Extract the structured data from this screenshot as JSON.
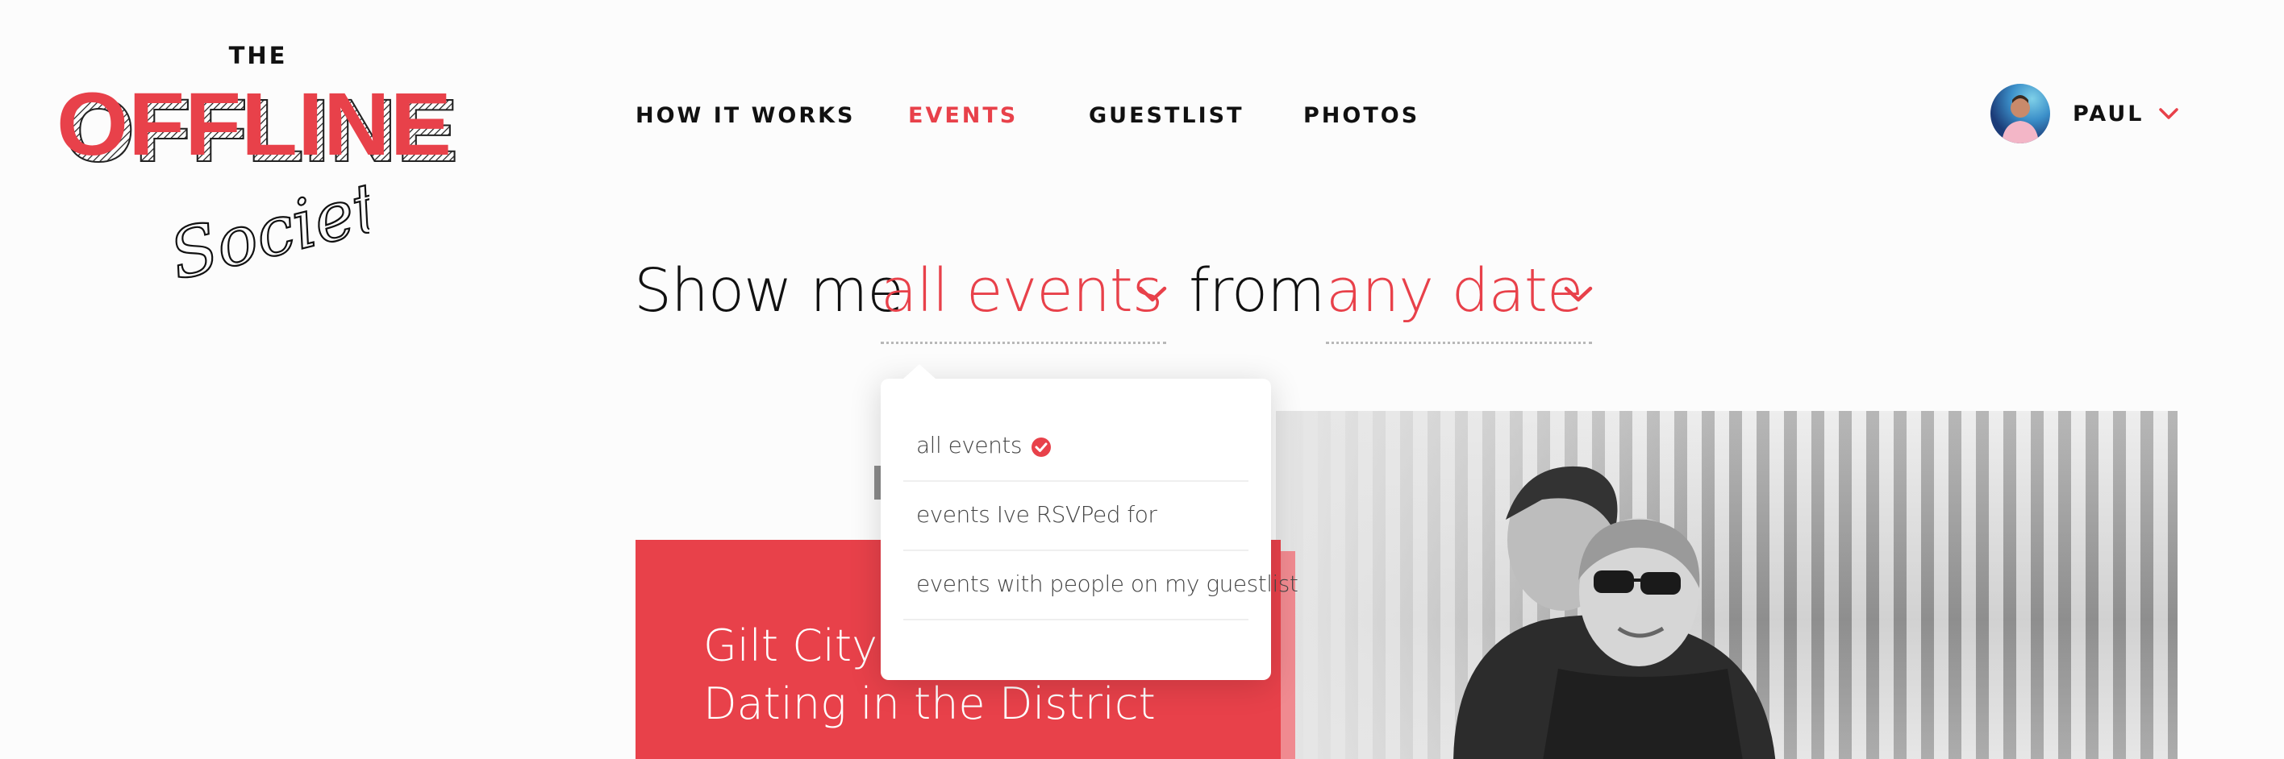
{
  "brand": {
    "logo_the": "THE",
    "logo_offline": "OFFLINE",
    "logo_society": "Society",
    "accent_color": "#e8414a"
  },
  "nav": {
    "items": [
      {
        "label": "HOW IT WORKS",
        "active": false
      },
      {
        "label": "EVENTS",
        "active": true
      },
      {
        "label": "GUESTLIST",
        "active": false
      },
      {
        "label": "PHOTOS",
        "active": false
      }
    ]
  },
  "user": {
    "name": "PAUL",
    "avatar_icon": "user-avatar",
    "menu_icon": "chevron-down-icon"
  },
  "filter": {
    "prefix": "Show me",
    "events_value": "all events",
    "connector": "from",
    "date_value": "any date"
  },
  "dropdown": {
    "options": [
      {
        "label": "all events",
        "selected": true
      },
      {
        "label": "events Ive RSVPed for",
        "selected": false
      },
      {
        "label": "events with people on my guestlist",
        "selected": false
      }
    ],
    "check_icon": "check-circle-icon"
  },
  "event_card": {
    "title": "Gilt City x Present: Dating in the District"
  }
}
